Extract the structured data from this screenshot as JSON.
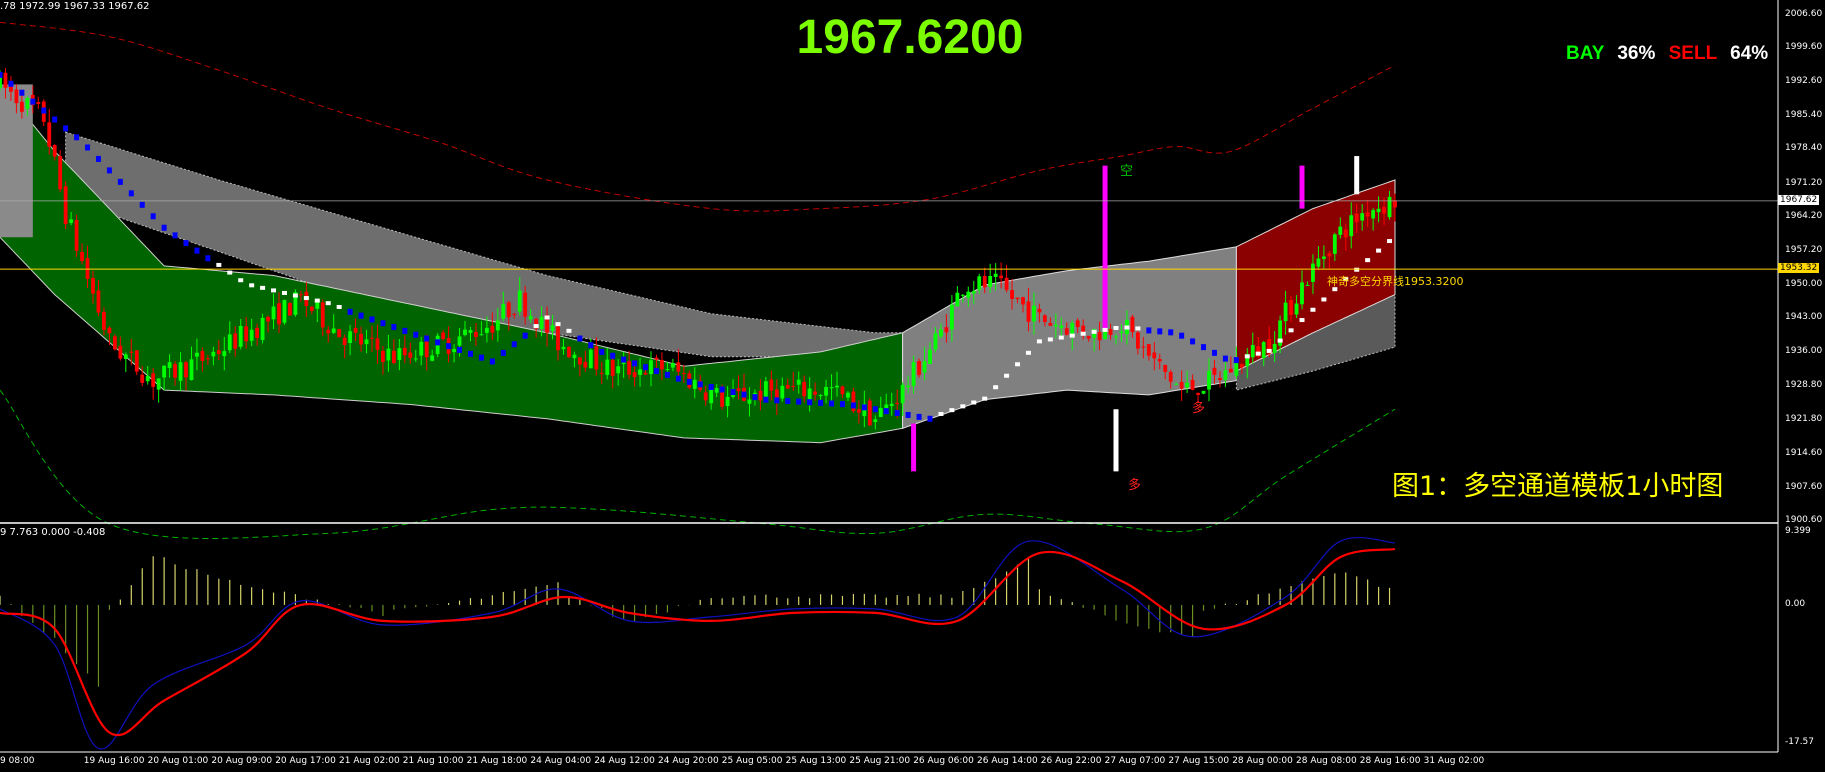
{
  "header": {
    "ohlc_text": ".78 1972.99 1967.33 1967.62",
    "big_price": "1967.6200"
  },
  "sentiment": {
    "bay_label": "BAY",
    "bay_pct": "36%",
    "sell_label": "SELL",
    "sell_pct": "64%"
  },
  "caption": "图1：多空通道模板1小时图",
  "boundary": {
    "label": "神奇多空分界线1953.3200",
    "price": 1953.32
  },
  "markers": {
    "kong": "空",
    "duo_1": "多",
    "duo_2": "多"
  },
  "indicator": {
    "values_text": "9 7.763 0.000 -0.408"
  },
  "colors": {
    "bull": "#00ff00",
    "bear": "#ff0000",
    "trend_blue": "#0000ff",
    "trend_white": "#ffffff",
    "bull_band": "#006400",
    "bear_band": "#8b0000",
    "grey_band": "#808080",
    "env_upper": "#c00000",
    "env_lower": "#00b000",
    "macd_signal": "#ff0000",
    "macd_line": "#1010c0",
    "histogram": "#d4d46a"
  },
  "chart_data": {
    "type": "candlestick",
    "price_axis": {
      "range": [
        1900.6,
        2008.0
      ],
      "ticks": [
        "2006.60",
        "1999.60",
        "1992.60",
        "1985.40",
        "1978.40",
        "1971.20",
        "1964.20",
        "1957.20",
        "1950.00",
        "1943.00",
        "1936.00",
        "1928.80",
        "1921.80",
        "1914.60",
        "1907.60",
        "1900.60"
      ],
      "current_tag": "1967.62",
      "boundary_tag": "1953.32"
    },
    "indicator_axis": {
      "range": [
        -17.57,
        9.399
      ],
      "ticks": [
        "9.399",
        "0.00",
        "-17.57"
      ]
    },
    "x_ticks": [
      "9 08:00",
      "19 Aug 16:00",
      "20 Aug 01:00",
      "20 Aug 09:00",
      "20 Aug 17:00",
      "21 Aug 02:00",
      "21 Aug 10:00",
      "21 Aug 18:00",
      "24 Aug 04:00",
      "24 Aug 12:00",
      "24 Aug 20:00",
      "25 Aug 05:00",
      "25 Aug 13:00",
      "25 Aug 21:00",
      "26 Aug 06:00",
      "26 Aug 14:00",
      "26 Aug 22:00",
      "27 Aug 07:00",
      "27 Aug 15:00",
      "28 Aug 00:00",
      "28 Aug 08:00",
      "28 Aug 16:00",
      "31 Aug 02:00"
    ],
    "price_keypoints": [
      [
        0,
        1992
      ],
      [
        8,
        1985
      ],
      [
        12,
        1965
      ],
      [
        20,
        1938
      ],
      [
        28,
        1930
      ],
      [
        38,
        1935
      ],
      [
        48,
        1942
      ],
      [
        55,
        1947
      ],
      [
        62,
        1940
      ],
      [
        72,
        1935
      ],
      [
        82,
        1938
      ],
      [
        90,
        1942
      ],
      [
        95,
        1947
      ],
      [
        102,
        1938
      ],
      [
        112,
        1932
      ],
      [
        122,
        1933
      ],
      [
        132,
        1926
      ],
      [
        142,
        1928
      ],
      [
        152,
        1928
      ],
      [
        160,
        1922
      ],
      [
        165,
        1928
      ],
      [
        172,
        1940
      ],
      [
        176,
        1950
      ],
      [
        182,
        1950
      ],
      [
        190,
        1943
      ],
      [
        200,
        1940
      ],
      [
        205,
        1942
      ],
      [
        210,
        1935
      ],
      [
        216,
        1928
      ],
      [
        222,
        1930
      ],
      [
        228,
        1935
      ],
      [
        232,
        1938
      ],
      [
        238,
        1950
      ],
      [
        244,
        1960
      ],
      [
        250,
        1966
      ],
      [
        255,
        1967.62
      ]
    ],
    "bar_count": 256,
    "bull_band": [
      [
        0,
        1992,
        1960
      ],
      [
        10,
        1978,
        1948
      ],
      [
        30,
        1954,
        1928
      ],
      [
        50,
        1952,
        1927
      ],
      [
        75,
        1946,
        1925
      ],
      [
        100,
        1940,
        1922
      ],
      [
        125,
        1933,
        1918
      ],
      [
        150,
        1936,
        1917
      ],
      [
        165,
        1940,
        1920
      ]
    ],
    "grey_band_1": [
      [
        12,
        1982,
        1968
      ],
      [
        40,
        1972,
        1957
      ],
      [
        70,
        1962,
        1945
      ],
      [
        100,
        1952,
        1940
      ],
      [
        130,
        1944,
        1935
      ],
      [
        160,
        1940,
        1935
      ],
      [
        165,
        1940,
        1935
      ]
    ],
    "grey_band_2": [
      [
        165,
        1940,
        1920
      ],
      [
        180,
        1950,
        1926
      ],
      [
        195,
        1953,
        1928
      ],
      [
        210,
        1955,
        1927
      ],
      [
        226,
        1958,
        1930
      ]
    ],
    "bear_band": [
      [
        226,
        1958,
        1932
      ],
      [
        240,
        1966,
        1940
      ],
      [
        255,
        1972,
        1948
      ]
    ],
    "grey_band_3": [
      [
        226,
        1938,
        1928
      ],
      [
        240,
        1944,
        1932
      ],
      [
        255,
        1948,
        1937
      ]
    ],
    "env_upper": [
      [
        0,
        2005
      ],
      [
        20,
        2002
      ],
      [
        40,
        1995
      ],
      [
        60,
        1987
      ],
      [
        80,
        1980
      ],
      [
        100,
        1972
      ],
      [
        130,
        1966
      ],
      [
        150,
        1966
      ],
      [
        170,
        1968
      ],
      [
        190,
        1974
      ],
      [
        205,
        1977
      ],
      [
        215,
        1979
      ],
      [
        225,
        1978
      ],
      [
        240,
        1987
      ],
      [
        255,
        1996
      ]
    ],
    "env_lower": [
      [
        0,
        1928
      ],
      [
        20,
        1900
      ],
      [
        60,
        1898
      ],
      [
        90,
        1903
      ],
      [
        110,
        1903
      ],
      [
        140,
        1900
      ],
      [
        160,
        1898
      ],
      [
        180,
        1902
      ],
      [
        200,
        1900
      ],
      [
        220,
        1899
      ],
      [
        235,
        1910
      ],
      [
        255,
        1924
      ]
    ],
    "trend_line": [
      [
        0,
        1994
      ],
      [
        15,
        1980
      ],
      [
        30,
        1962
      ],
      [
        45,
        1950
      ],
      [
        60,
        1946
      ],
      [
        75,
        1940
      ],
      [
        90,
        1934
      ],
      [
        100,
        1943
      ],
      [
        110,
        1936
      ],
      [
        125,
        1930
      ],
      [
        140,
        1926
      ],
      [
        155,
        1925
      ],
      [
        170,
        1922
      ],
      [
        180,
        1926
      ],
      [
        190,
        1938
      ],
      [
        205,
        1941
      ],
      [
        215,
        1940
      ],
      [
        225,
        1934
      ],
      [
        232,
        1936
      ],
      [
        245,
        1950
      ],
      [
        255,
        1960
      ]
    ],
    "macd_signal": [
      [
        0,
        -1
      ],
      [
        10,
        -3
      ],
      [
        20,
        -16
      ],
      [
        30,
        -12
      ],
      [
        45,
        -6
      ],
      [
        55,
        0
      ],
      [
        70,
        -2
      ],
      [
        90,
        -1.5
      ],
      [
        103,
        1
      ],
      [
        115,
        -1
      ],
      [
        130,
        -2
      ],
      [
        145,
        -1
      ],
      [
        160,
        -1
      ],
      [
        175,
        -2
      ],
      [
        190,
        6.5
      ],
      [
        205,
        3
      ],
      [
        220,
        -3
      ],
      [
        235,
        0
      ],
      [
        245,
        6
      ],
      [
        255,
        7
      ]
    ],
    "macd_line": [
      [
        0,
        -0.5
      ],
      [
        10,
        -5
      ],
      [
        18,
        -18
      ],
      [
        28,
        -10
      ],
      [
        45,
        -5
      ],
      [
        55,
        0.5
      ],
      [
        70,
        -2.5
      ],
      [
        90,
        -1
      ],
      [
        102,
        2
      ],
      [
        115,
        -2
      ],
      [
        130,
        -1.5
      ],
      [
        145,
        -0.5
      ],
      [
        160,
        -0.5
      ],
      [
        175,
        -1.5
      ],
      [
        188,
        8
      ],
      [
        205,
        2
      ],
      [
        218,
        -4
      ],
      [
        235,
        1
      ],
      [
        245,
        8
      ],
      [
        255,
        7.763
      ]
    ]
  }
}
